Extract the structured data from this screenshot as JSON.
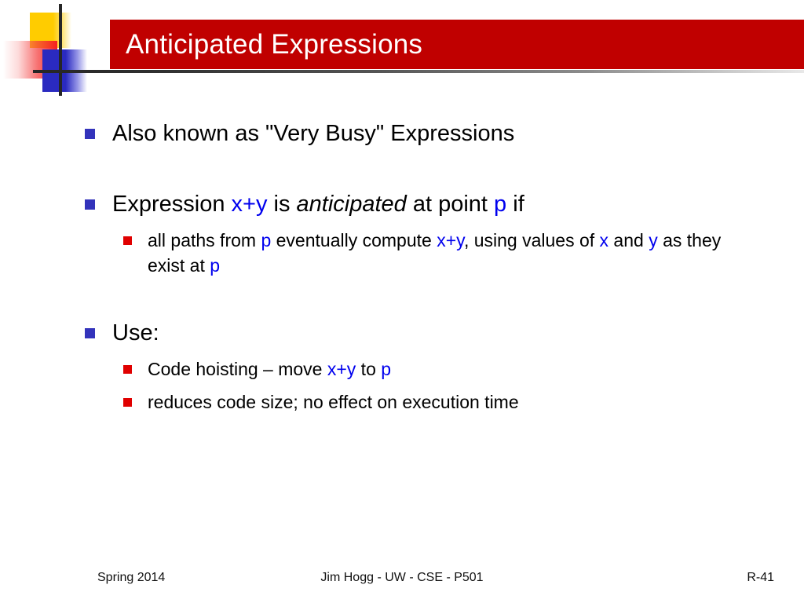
{
  "slide": {
    "title": "Anticipated Expressions",
    "banner_color": "#c00000",
    "accent_blue": "#0000ee",
    "bullet_blue": "#3333bb",
    "bullet_red": "#e00000"
  },
  "logo": {
    "yellow": "#ffcc00",
    "red": "#f42020",
    "blue": "#2a2ac0",
    "line": "#262626"
  },
  "content": {
    "b1": {
      "text": "Also known as \"Very Busy\" Expressions"
    },
    "b2": {
      "p1": "Expression ",
      "xy": "x+y",
      "p2": " is ",
      "anticipated": "anticipated",
      "p3": " at point ",
      "p": "p",
      "p4": " if",
      "sub1": {
        "s1": "all paths from ",
        "p_a": "p",
        "s2": " eventually compute ",
        "xy": "x+y",
        "s3": ", using values of ",
        "x": "x",
        "s4": " and ",
        "y": "y",
        "s5": " as they exist at ",
        "p_b": "p"
      }
    },
    "b3": {
      "text": "Use:",
      "sub1": {
        "s1": "Code hoisting – move ",
        "xy": "x+y",
        "s2": " to ",
        "p": "p"
      },
      "sub2": {
        "text": "reduces code size; no effect on execution time"
      }
    }
  },
  "footer": {
    "left": "Spring 2014",
    "center": "Jim Hogg - UW - CSE - P501",
    "right": "R-41"
  }
}
